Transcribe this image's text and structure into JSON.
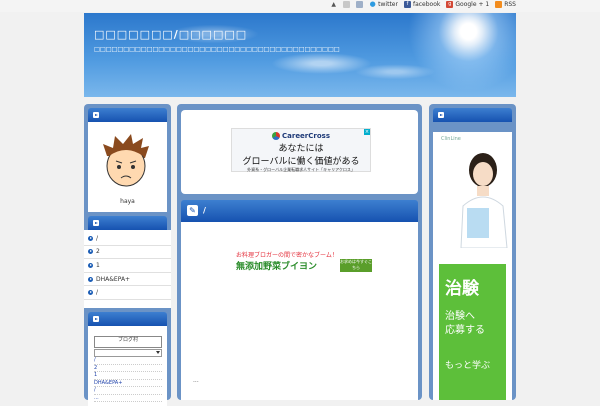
{
  "topbar": {
    "links": [
      {
        "icon": "up-arrow-icon",
        "label": ""
      },
      {
        "icon": "mail-icon",
        "label": ""
      },
      {
        "icon": "profile-icon",
        "label": ""
      },
      {
        "icon": "twitter-icon",
        "label": "twitter"
      },
      {
        "icon": "facebook-icon",
        "label": "facebook"
      },
      {
        "icon": "google-plus-icon",
        "label": "Google + 1"
      },
      {
        "icon": "rss-icon",
        "label": "RSS"
      }
    ]
  },
  "header": {
    "title": "□□□□□□□/□□□□□□",
    "description": "□□□□□□□□□□□□□□□□□□□□□□□□□□□□□□□□□□□□□□□□□□"
  },
  "sidebar_left": {
    "profile_name": "haya",
    "categories": [
      "/",
      "2",
      "1",
      "DHA&EPA+",
      "/"
    ],
    "ranking": {
      "banner": "ブログ村",
      "items": [
        "/",
        "2",
        "1",
        "DHA&EPA+",
        "/",
        "..."
      ]
    }
  },
  "main": {
    "ad": {
      "brand": "CareerCross",
      "line1": "あなたには",
      "line2": "グローバルに働く価値がある",
      "line3": "外資系・グローバル企業転職求人サイト「キャリアクロス」"
    },
    "post": {
      "title": "/",
      "ad_line1": "お料理ブロガーの間で密かなブーム！",
      "ad_line2": "無添加野菜ブイヨン",
      "ad_badge": "お求めは今すぐこちら",
      "footer": "..."
    }
  },
  "sidebar_right": {
    "ad": {
      "logo": "ClinLine",
      "headline": "治験",
      "body": "治験へ\n応募する",
      "cta": "もっと学ぶ"
    }
  },
  "colors": {
    "accent": "#1652b0",
    "frame": "#6b93c6",
    "ad_green": "#5dbf3a"
  }
}
